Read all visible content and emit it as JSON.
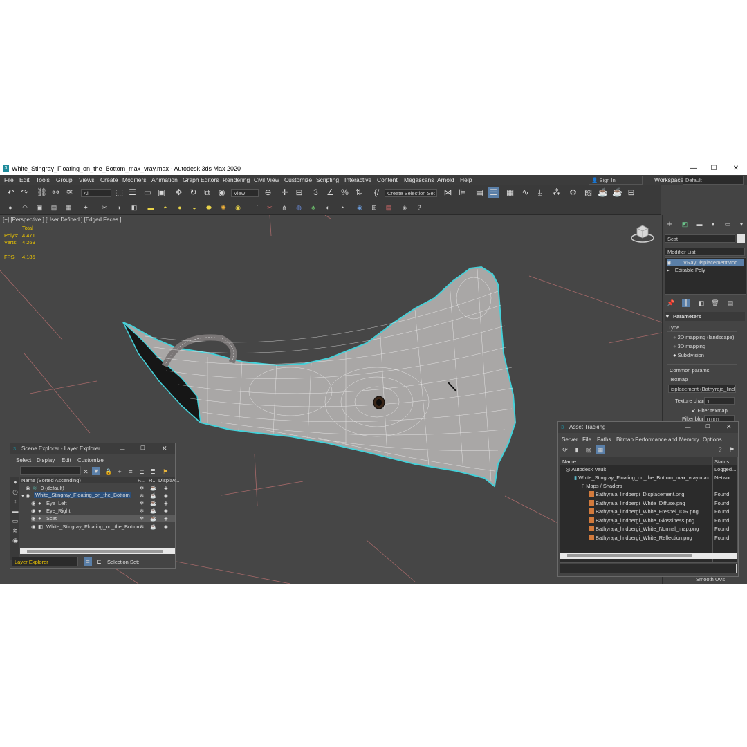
{
  "window": {
    "title": "White_Stingray_Floating_on_the_Bottom_max_vray.max - Autodesk 3ds Max 2020",
    "min_label": "—",
    "max_label": "☐",
    "close_label": "✕"
  },
  "menu": [
    "File",
    "Edit",
    "Tools",
    "Group",
    "Views",
    "Create",
    "Modifiers",
    "Animation",
    "Graph Editors",
    "Rendering",
    "Civil View",
    "Customize",
    "Scripting",
    "Interactive",
    "Content",
    "Megascans",
    "Arnold",
    "Help"
  ],
  "account": {
    "sign_in": "Sign In",
    "workspaces_label": "Workspaces:",
    "workspace_value": "Default"
  },
  "toolbar": {
    "selection_filter": "All",
    "view_combo": "View",
    "selection_set": "Create Selection Set"
  },
  "viewport": {
    "label": "[+] [Perspective ] [User Defined ] [Edged Faces ]",
    "stats": {
      "total_label": "Total",
      "polys_label": "Polys:",
      "polys_value": "4 471",
      "verts_label": "Verts:",
      "verts_value": "4 269",
      "fps_label": "FPS:",
      "fps_value": "4.185"
    }
  },
  "command_panel": {
    "object_name": "Scat",
    "modifier_list_label": "Modifier List",
    "stack": [
      "VRayDisplacementMod",
      "Editable Poly"
    ],
    "rollout_title": "Parameters",
    "type_label": "Type",
    "type_options": [
      "2D mapping (landscape)",
      "3D mapping",
      "Subdivision"
    ],
    "common_params_label": "Common params",
    "texmap_label": "Texmap",
    "texmap_value": "isplacement (Bathyraja_lindber",
    "texture_chan_label": "Texture chan",
    "texture_chan_value": "1",
    "filter_texmap_label": "Filter texmap",
    "filter_blur_label": "Filter blur",
    "filter_blur_value": "0.001",
    "smooth_uvs_label": "Smooth UVs"
  },
  "scene_explorer": {
    "title": "Scene Explorer - Layer Explorer",
    "menu": [
      "Select",
      "Display",
      "Edit",
      "Customize"
    ],
    "col_name": "Name (Sorted Ascending)",
    "col_f": "F...",
    "col_r": "R...",
    "col_display": "Display...",
    "rows": [
      "0 (default)",
      "White_Stingray_Floating_on_the_Bottom",
      "Eye_Left",
      "Eye_Right",
      "Scat",
      "White_Stingray_Floating_on_the_Bottom"
    ],
    "footer_layer": "Layer Explorer",
    "footer_selset": "Selection Set:"
  },
  "asset_tracking": {
    "title": "Asset Tracking",
    "menu": [
      "Server",
      "File",
      "Paths",
      "Bitmap Performance and Memory",
      "Options"
    ],
    "col_name": "Name",
    "col_status": "Status",
    "rows": [
      {
        "name": "Autodesk Vault",
        "status": "Logged..."
      },
      {
        "name": "White_Stingray_Floating_on_the_Bottom_max_vray.max",
        "status": "Networ..."
      },
      {
        "name": "Maps / Shaders",
        "status": ""
      },
      {
        "name": "Bathyraja_lindbergi_Displacement.png",
        "status": "Found"
      },
      {
        "name": "Bathyraja_lindbergi_White_Diffuse.png",
        "status": "Found"
      },
      {
        "name": "Bathyraja_lindbergi_White_Fresnel_IOR.png",
        "status": "Found"
      },
      {
        "name": "Bathyraja_lindbergi_White_Glossiness.png",
        "status": "Found"
      },
      {
        "name": "Bathyraja_lindbergi_White_Normal_map.png",
        "status": "Found"
      },
      {
        "name": "Bathyraja_lindbergi_White_Reflection.png",
        "status": "Found"
      }
    ]
  }
}
